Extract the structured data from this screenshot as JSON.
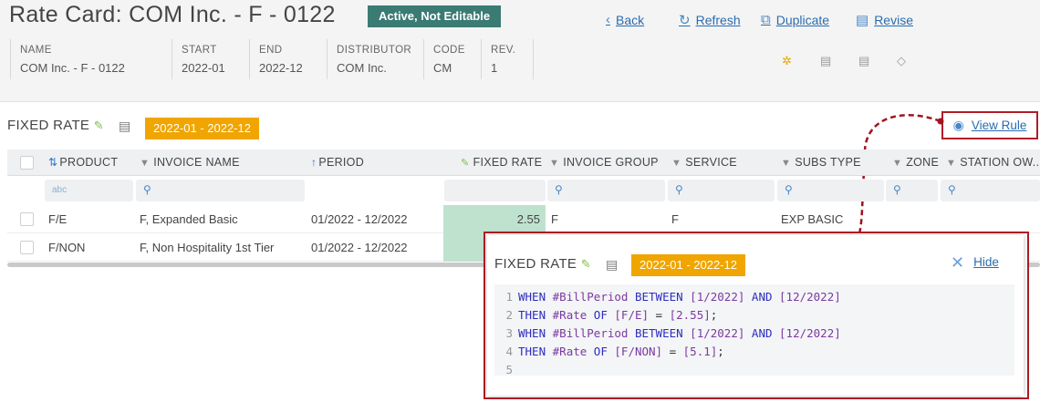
{
  "header": {
    "title": "Rate Card: COM Inc. - F - 0122",
    "status": "Active, Not Editable",
    "actions": {
      "back": "Back",
      "refresh": "Refresh",
      "duplicate": "Duplicate",
      "revise": "Revise"
    },
    "meta": [
      {
        "label": "NAME",
        "value": "COM Inc. - F - 0122"
      },
      {
        "label": "START",
        "value": "2022-01"
      },
      {
        "label": "END",
        "value": "2022-12"
      },
      {
        "label": "DISTRIBUTOR",
        "value": "COM  Inc."
      },
      {
        "label": "CODE",
        "value": "CM"
      },
      {
        "label": "REV.",
        "value": "1"
      }
    ]
  },
  "section": {
    "title": "FIXED RATE",
    "period_badge": "2022-01 - 2022-12",
    "view_rule": "View Rule"
  },
  "table": {
    "columns": [
      "PRODUCT",
      "INVOICE NAME",
      "PERIOD",
      "FIXED RATE",
      "INVOICE GROUP",
      "SERVICE",
      "SUBS TYPE",
      "ZONE",
      "STATION OW..."
    ],
    "product_filter_text": "abc",
    "rows": [
      {
        "product": "F/E",
        "invoice_name": "F, Expanded Basic",
        "period": "01/2022 - 12/2022",
        "fixed_rate": "2.55",
        "invoice_group": "F",
        "service": "F",
        "subs_type": "EXP BASIC"
      },
      {
        "product": "F/NON",
        "invoice_name": "F, Non Hospitality 1st Tier",
        "period": "01/2022 - 12/2022",
        "fixed_rate": "",
        "invoice_group": "",
        "service": "",
        "subs_type": ""
      }
    ]
  },
  "popup": {
    "title": "FIXED RATE",
    "period_badge": "2022-01 - 2022-12",
    "hide": "Hide",
    "code": [
      {
        "n": "1",
        "t": [
          [
            "kw",
            "WHEN "
          ],
          [
            "var",
            "#BillPeriod"
          ],
          [
            "kw",
            " BETWEEN "
          ],
          [
            "br",
            "[1/2022]"
          ],
          [
            "kw",
            " AND "
          ],
          [
            "br",
            "[12/2022]"
          ]
        ]
      },
      {
        "n": "2",
        "t": [
          [
            "kw",
            "THEN "
          ],
          [
            "var",
            "#Rate"
          ],
          [
            "kw",
            " OF "
          ],
          [
            "br",
            "[F/E]"
          ],
          [
            "op",
            " = "
          ],
          [
            "br",
            "[2.55]"
          ],
          [
            "op",
            ";"
          ]
        ]
      },
      {
        "n": "3",
        "t": [
          [
            "kw",
            "WHEN "
          ],
          [
            "var",
            "#BillPeriod"
          ],
          [
            "kw",
            " BETWEEN "
          ],
          [
            "br",
            "[1/2022]"
          ],
          [
            "kw",
            " AND "
          ],
          [
            "br",
            "[12/2022]"
          ]
        ]
      },
      {
        "n": "4",
        "t": [
          [
            "kw",
            "THEN "
          ],
          [
            "var",
            "#Rate"
          ],
          [
            "kw",
            " OF "
          ],
          [
            "br",
            "[F/NON]"
          ],
          [
            "op",
            " = "
          ],
          [
            "br",
            "[5.1]"
          ],
          [
            "op",
            ";"
          ]
        ]
      },
      {
        "n": "5",
        "t": []
      }
    ]
  }
}
